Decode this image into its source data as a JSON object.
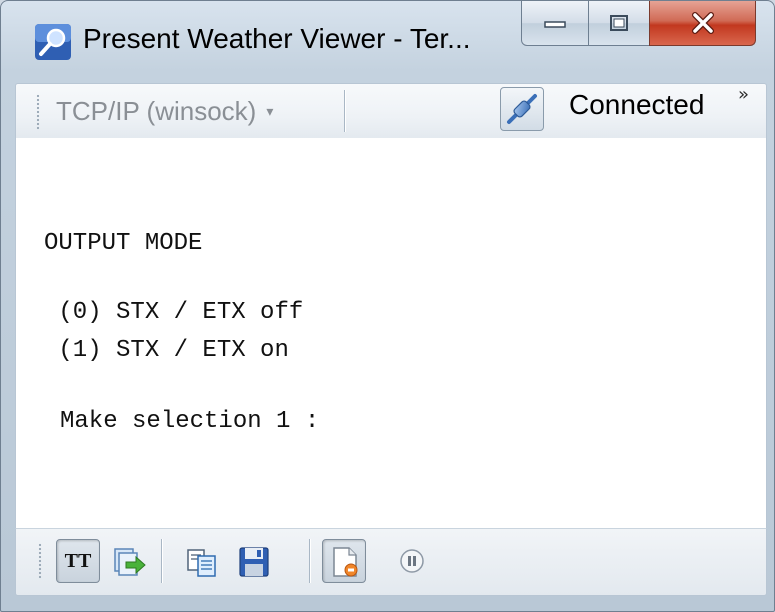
{
  "window": {
    "title": "Present Weather Viewer - Ter...",
    "app_icon": "magnifier-icon",
    "caption_buttons": [
      "minimize-icon",
      "maximize-icon",
      "close-icon"
    ]
  },
  "toolbar_top": {
    "connection_type": "TCP/IP (winsock)",
    "connection_type_caret": "▾",
    "connect_icon": "plug-connector-icon",
    "status_label": "Connected",
    "overflow_chevron": "»"
  },
  "terminal": {
    "lines": [
      "OUTPUT MODE",
      " (0) STX / ETX off",
      " (1) STX / ETX on",
      "Make selection 1 :"
    ]
  },
  "toolbar_bottom": {
    "tt_label": "TT",
    "buttons": [
      "text-mode-icon",
      "send-file-icon",
      "copy-icon",
      "save-icon",
      "log-file-icon",
      "pause-icon"
    ]
  }
}
